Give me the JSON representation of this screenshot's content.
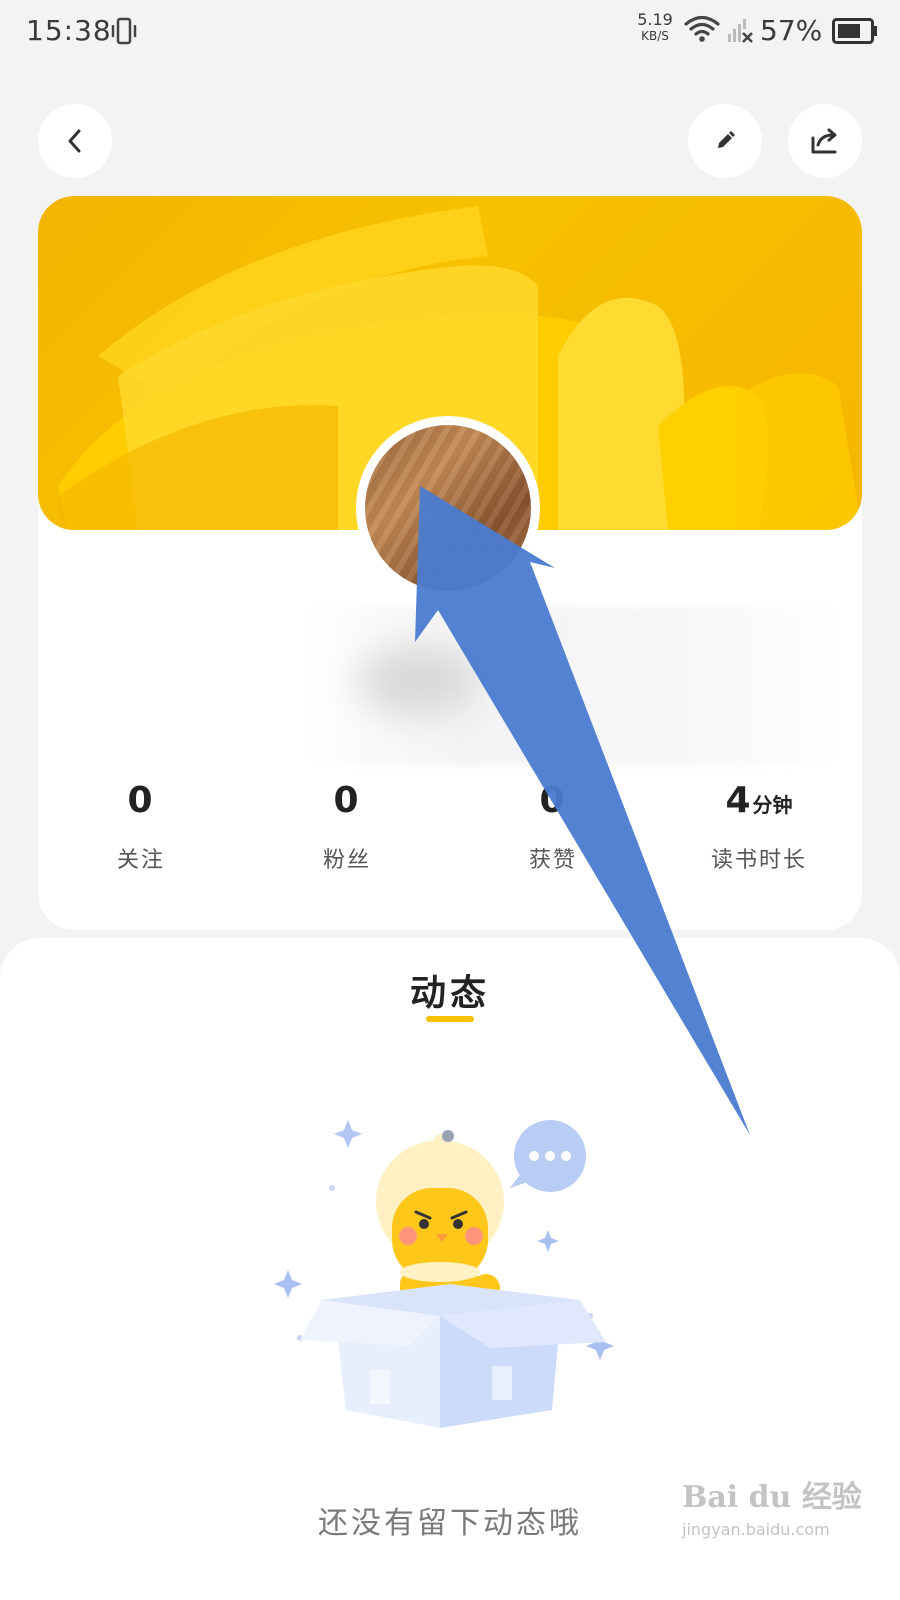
{
  "status_bar": {
    "time": "15:38",
    "net_speed_value": "5.19",
    "net_speed_unit": "KB/S",
    "battery": "57%"
  },
  "top_actions": {
    "back_icon": "chevron-left-icon",
    "edit_icon": "pencil-icon",
    "share_icon": "share-icon"
  },
  "profile": {
    "stats": [
      {
        "value": "0",
        "unit": "",
        "label": "关注"
      },
      {
        "value": "0",
        "unit": "",
        "label": "粉丝"
      },
      {
        "value": "0",
        "unit": "",
        "label": "获赞"
      },
      {
        "value": "4",
        "unit": "分钟",
        "label": "读书时长"
      }
    ]
  },
  "feed": {
    "tab_label": "动态",
    "empty_text": "还没有留下动态哦"
  },
  "watermark": {
    "main": "Bai du 经验",
    "sub": "jingyan.baidu.com"
  },
  "colors": {
    "accent": "#f7c100",
    "annotation_arrow": "#4a7bd0"
  }
}
